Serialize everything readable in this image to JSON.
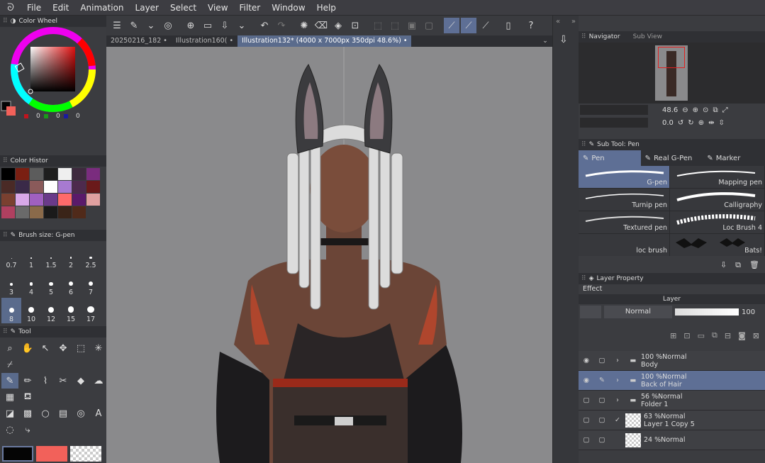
{
  "menu": [
    "File",
    "Edit",
    "Animation",
    "Layer",
    "Select",
    "View",
    "Filter",
    "Window",
    "Help"
  ],
  "tabs": {
    "t1": "20250216_182",
    "t2": "Illustration160(",
    "t3": "Illustration132* (4000 x 7000px 350dpi 48.6%)"
  },
  "left": {
    "color_wheel_title": "Color Wheel",
    "color_values": [
      "0",
      "0",
      "0"
    ],
    "history_title": "Color Histor",
    "brush_title": "Brush size: G-pen",
    "brush_sizes": [
      "0.7",
      "1",
      "1.5",
      "2",
      "2.5",
      "3",
      "4",
      "5",
      "6",
      "7",
      "8",
      "10",
      "12",
      "15",
      "17"
    ],
    "tool_title": "Tool"
  },
  "colors": {
    "main": "#050505",
    "sub": "#f2615a",
    "accent": "#5e6f95",
    "history": [
      "#000000",
      "#7a1f12",
      "#5c5c5c",
      "#1e1e1e",
      "#efefef",
      "#3e2a3e",
      "#7a2c7e",
      "#4a2a26",
      "#3a2a48",
      "#8a5a5a",
      "#ffffff",
      "#a77ad0",
      "#4d2a4d",
      "#6a1a1a",
      "#7a4030",
      "#d8a8e8",
      "#a060c0",
      "#6a3a8a",
      "#ff6a6a",
      "#5a1a6a",
      "#e0a0a0",
      "#b04060",
      "#6a6a6a",
      "#8a6a4a",
      "#1a1a1a",
      "#3a2418",
      "#502a1a"
    ]
  },
  "navigator": {
    "title": "Navigator",
    "subview": "Sub View",
    "zoom": "48.6",
    "rotation": "0.0"
  },
  "subtool": {
    "title": "Sub Tool: Pen",
    "tabs": [
      "Pen",
      "Real G-Pen",
      "Marker"
    ],
    "brushes": [
      "G-pen",
      "Mapping pen",
      "Turnip pen",
      "Calligraphy",
      "Textured pen",
      "Loc Brush 4",
      "loc brush",
      "Bats!"
    ]
  },
  "layer_property": {
    "title": "Layer Property",
    "effect": "Effect"
  },
  "layer": {
    "title": "Layer",
    "blend": "Normal",
    "opacity": "100",
    "rows": [
      {
        "pct": "100 %Normal",
        "name": "Body"
      },
      {
        "pct": "100 %Normal",
        "name": "Back of Hair"
      },
      {
        "pct": "56 %Normal",
        "name": "Folder 1"
      },
      {
        "pct": "63 %Normal",
        "name": "Layer 1 Copy 5"
      },
      {
        "pct": "24 %Normal",
        "name": ""
      }
    ]
  }
}
